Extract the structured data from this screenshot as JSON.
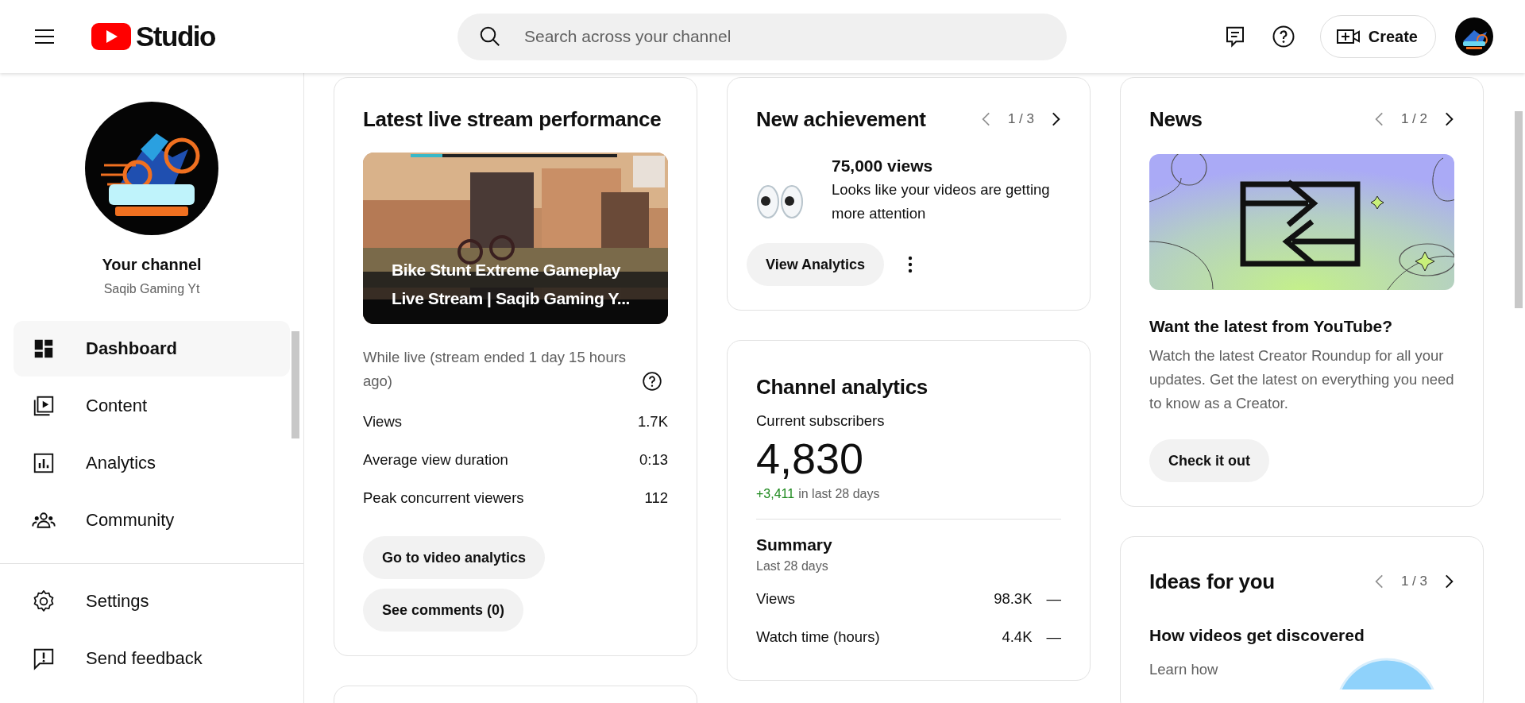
{
  "header": {
    "logo_text": "Studio",
    "search": {
      "placeholder": "Search across your channel"
    },
    "create_button": "Create"
  },
  "sidebar": {
    "channel_label": "Your channel",
    "channel_name": "Saqib Gaming Yt",
    "items": [
      {
        "label": "Dashboard",
        "selected": true
      },
      {
        "label": "Content",
        "selected": false
      },
      {
        "label": "Analytics",
        "selected": false
      },
      {
        "label": "Community",
        "selected": false
      }
    ],
    "footer_items": [
      {
        "label": "Settings"
      },
      {
        "label": "Send feedback"
      }
    ]
  },
  "live_stream_card": {
    "title": "Latest live stream performance",
    "video_title": "Bike Stunt Extreme Gameplay Live Stream | Saqib Gaming Y...",
    "note": "While live (stream ended 1 day 15 hours ago)",
    "stats": [
      {
        "label": "Views",
        "value": "1.7K"
      },
      {
        "label": "Average view duration",
        "value": "0:13"
      },
      {
        "label": "Peak concurrent viewers",
        "value": "112"
      }
    ],
    "buttons": [
      "Go to video analytics",
      "See comments (0)"
    ]
  },
  "achievement_card": {
    "title": "New achievement",
    "pager": "1 / 3",
    "headline": "75,000 views",
    "text": "Looks like your videos are getting more attention",
    "button": "View Analytics"
  },
  "channel_analytics_card": {
    "title": "Channel analytics",
    "subscribers_label": "Current subscribers",
    "subscribers": "4,830",
    "change": "+3,411",
    "change_suffix": "in last 28 days",
    "summary_title": "Summary",
    "summary_period": "Last 28 days",
    "stats": [
      {
        "label": "Views",
        "value": "98.3K",
        "trend": "—"
      },
      {
        "label": "Watch time (hours)",
        "value": "4.4K",
        "trend": "—"
      }
    ]
  },
  "news_card": {
    "title": "News",
    "pager": "1 / 2",
    "headline": "Want the latest from YouTube?",
    "text": "Watch the latest Creator Roundup for all your updates. Get the latest on everything you need to know as a Creator.",
    "button": "Check it out"
  },
  "ideas_card": {
    "title": "Ideas for you",
    "pager": "1 / 3",
    "headline": "How videos get discovered",
    "text": "Learn how"
  }
}
